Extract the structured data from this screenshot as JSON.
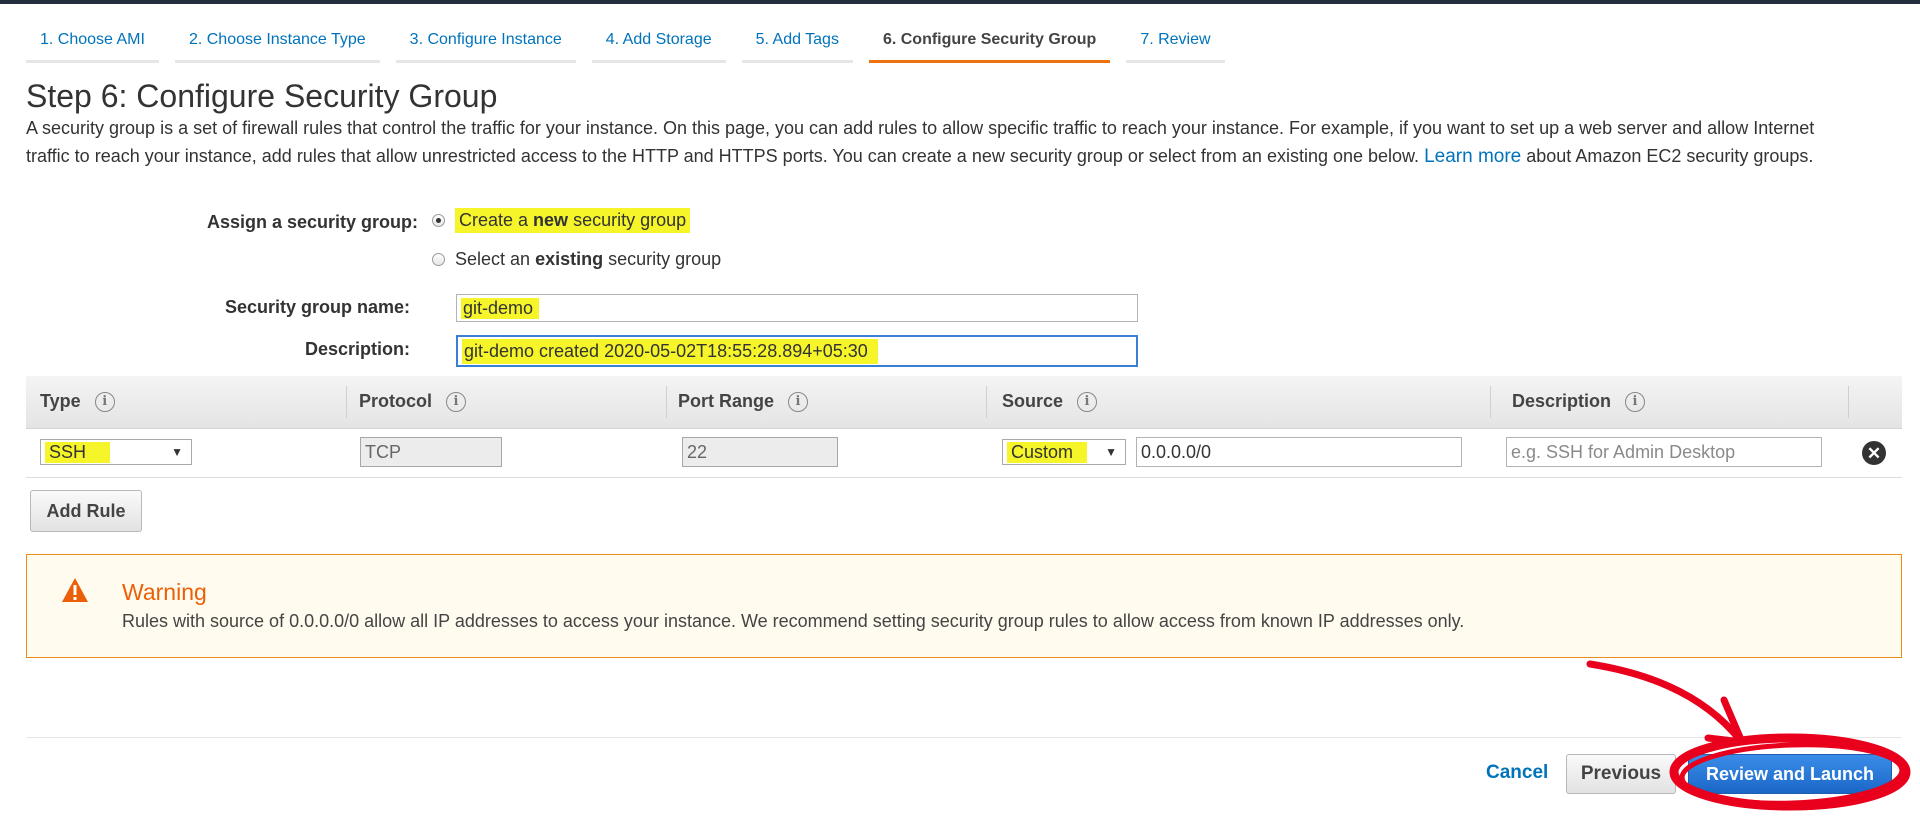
{
  "wizard": {
    "tabs": [
      {
        "label": "1. Choose AMI",
        "active": false
      },
      {
        "label": "2. Choose Instance Type",
        "active": false
      },
      {
        "label": "3. Configure Instance",
        "active": false
      },
      {
        "label": "4. Add Storage",
        "active": false
      },
      {
        "label": "5. Add Tags",
        "active": false
      },
      {
        "label": "6. Configure Security Group",
        "active": true
      },
      {
        "label": "7. Review",
        "active": false
      }
    ]
  },
  "page": {
    "title": "Step 6: Configure Security Group",
    "intro_text": "A security group is a set of firewall rules that control the traffic for your instance. On this page, you can add rules to allow specific traffic to reach your instance. For example, if you want to set up a web server and allow Internet traffic to reach your instance, add rules that allow unrestricted access to the HTTP and HTTPS ports. You can create a new security group or select from an existing one below.",
    "learn_more": "Learn more",
    "intro_suffix": "about Amazon EC2 security groups."
  },
  "assign": {
    "label": "Assign a security group:",
    "option_new": {
      "prefix": "Create a ",
      "bold": "new",
      "suffix": " security group",
      "checked": true
    },
    "option_existing": {
      "prefix": "Select an ",
      "bold": "existing",
      "suffix": " security group",
      "checked": false
    }
  },
  "form": {
    "name_label": "Security group name:",
    "name_value": "git-demo",
    "description_label": "Description:",
    "description_value": "git-demo created 2020-05-02T18:55:28.894+05:30"
  },
  "rules": {
    "columns": [
      "Type",
      "Protocol",
      "Port Range",
      "Source",
      "Description"
    ],
    "rows": [
      {
        "type": "SSH",
        "protocol": "TCP",
        "port_range": "22",
        "source_mode": "Custom",
        "source_cidr": "0.0.0.0/0",
        "description_placeholder": "e.g. SSH for Admin Desktop"
      }
    ],
    "add_rule_label": "Add Rule"
  },
  "warning": {
    "title": "Warning",
    "text": "Rules with source of 0.0.0.0/0 allow all IP addresses to access your instance. We recommend setting security group rules to allow access from known IP addresses only."
  },
  "footer": {
    "cancel": "Cancel",
    "previous": "Previous",
    "review_launch": "Review and Launch"
  },
  "colors": {
    "link": "#0073bb",
    "active_tab_underline": "#ec7211",
    "highlight": "#f5f52a",
    "annotation_red": "#e8001c",
    "warning_border": "#eb8c1e",
    "warning_title": "#eb5f07",
    "primary_button": "#1a66c7"
  }
}
